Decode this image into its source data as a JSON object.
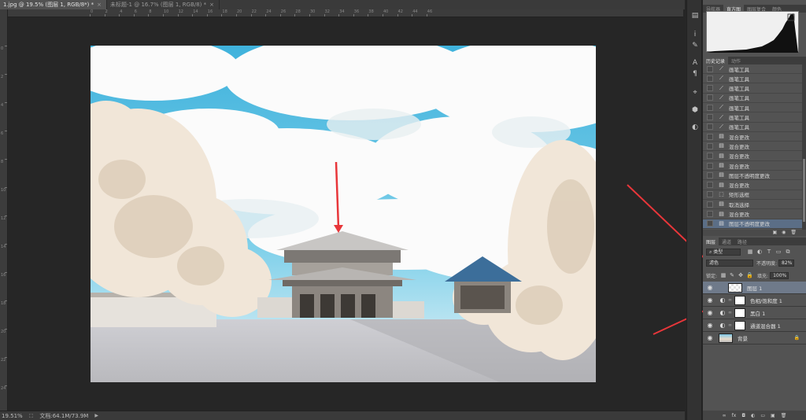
{
  "tabs": [
    {
      "label": "1.jpg @ 19.5% (图层 1, RGB/8*) *",
      "active": true
    },
    {
      "label": "未标题-1 @ 16.7% (图层 1, RGB/8) *",
      "active": false
    }
  ],
  "ruler_top_numbers": [
    "0",
    "2",
    "4",
    "6",
    "8",
    "10",
    "12",
    "14",
    "16",
    "18",
    "20",
    "22",
    "24",
    "26",
    "28",
    "30",
    "32",
    "34",
    "36",
    "38",
    "40",
    "42",
    "44",
    "46"
  ],
  "ruler_left_numbers": [
    "0",
    "2",
    "4",
    "6",
    "8",
    "10",
    "12",
    "14",
    "16",
    "18",
    "20",
    "22",
    "24"
  ],
  "status": {
    "zoom": "19.51%",
    "doc": "文档:64.1M/73.9M"
  },
  "strip_icons": [
    "histogram-toggle-icon",
    "info-icon",
    "brush-icon",
    "paragraph-icon",
    "character-icon",
    "navigator-icon",
    "3d-icon",
    "color-icon"
  ],
  "top_panel": {
    "tabs": [
      "导航器",
      "直方图",
      "图层复合",
      "颜色"
    ],
    "active_tab": "直方图"
  },
  "history_panel": {
    "tabs": [
      "历史记录",
      "动作"
    ],
    "items": [
      {
        "label": "画笔工具",
        "icon": "brush"
      },
      {
        "label": "画笔工具",
        "icon": "brush"
      },
      {
        "label": "画笔工具",
        "icon": "brush"
      },
      {
        "label": "画笔工具",
        "icon": "brush"
      },
      {
        "label": "画笔工具",
        "icon": "brush"
      },
      {
        "label": "画笔工具",
        "icon": "brush"
      },
      {
        "label": "画笔工具",
        "icon": "brush"
      },
      {
        "label": "混合更改",
        "icon": "doc"
      },
      {
        "label": "混合更改",
        "icon": "doc"
      },
      {
        "label": "混合更改",
        "icon": "doc"
      },
      {
        "label": "混合更改",
        "icon": "doc"
      },
      {
        "label": "图层不透明度更改",
        "icon": "doc"
      },
      {
        "label": "混合更改",
        "icon": "doc"
      },
      {
        "label": "矩形选框",
        "icon": "marquee"
      },
      {
        "label": "取消选择",
        "icon": "doc"
      },
      {
        "label": "混合更改",
        "icon": "doc"
      },
      {
        "label": "图层不透明度更改",
        "icon": "doc"
      }
    ]
  },
  "layers_panel": {
    "tabs": [
      "图层",
      "通道",
      "路径"
    ],
    "filter": "类型",
    "blend_mode": "滤色",
    "opacity_label": "不透明度:",
    "opacity_value": "82%",
    "lock_label": "锁定:",
    "fill_label": "填充:",
    "fill_value": "100%",
    "layers": [
      {
        "name": "图层 1",
        "type": "pixel",
        "selected": true
      },
      {
        "name": "色相/饱和度 1",
        "type": "adjustment",
        "selected": false
      },
      {
        "name": "黑白 1",
        "type": "adjustment",
        "selected": false
      },
      {
        "name": "通道混合器 1",
        "type": "adjustment",
        "selected": false
      },
      {
        "name": "背景",
        "type": "background",
        "selected": false
      }
    ]
  },
  "annotation_color": "#e8363a"
}
